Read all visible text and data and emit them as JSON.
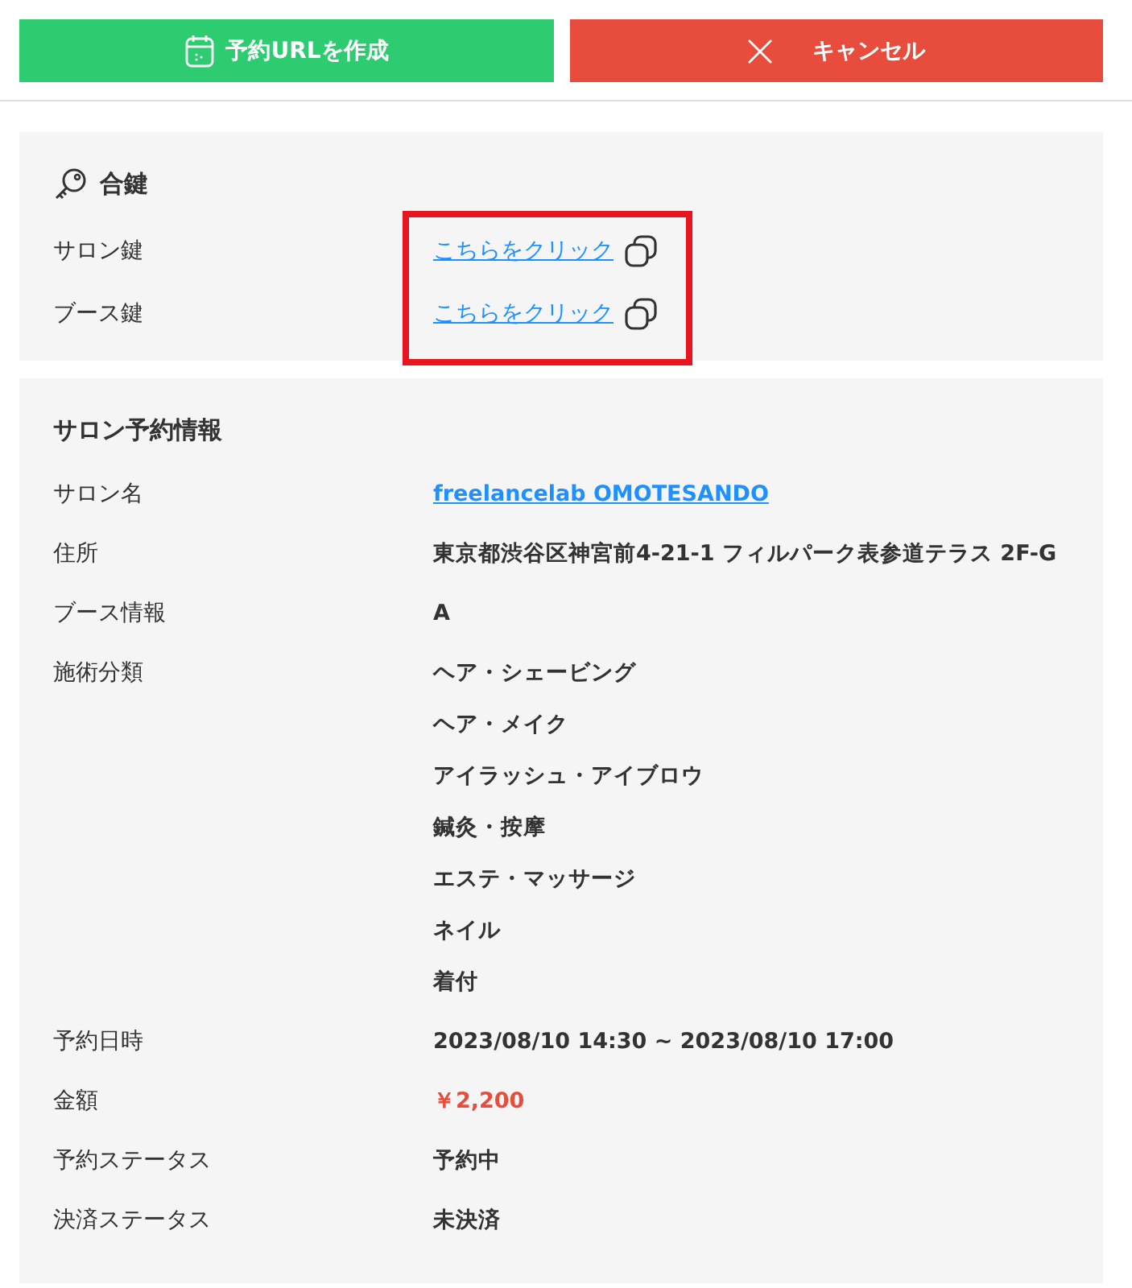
{
  "actions": [
    {
      "kind": "create",
      "label": "予約URLを作成"
    },
    {
      "kind": "cancel",
      "label": "キャンセル"
    }
  ],
  "keys": {
    "title": "合鍵",
    "highlighted": true,
    "rows": [
      {
        "label": "サロン鍵",
        "link": "こちらをクリック"
      },
      {
        "label": "ブース鍵",
        "link": "こちらをクリック"
      }
    ]
  },
  "reservation": {
    "title": "サロン予約情報",
    "rows": [
      {
        "kind": "link",
        "label": "サロン名",
        "value": "freelancelab OMOTESANDO"
      },
      {
        "kind": "text",
        "label": "住所",
        "value": "東京都渋谷区神宮前4-21-1 フィルパーク表参道テラス 2F-G"
      },
      {
        "kind": "text",
        "label": "ブース情報",
        "value": "A"
      },
      {
        "kind": "list",
        "label": "施術分類",
        "values": [
          "ヘア・シェービング",
          "ヘア・メイク",
          "アイラッシュ・アイブロウ",
          "鍼灸・按摩",
          "エステ・マッサージ",
          "ネイル",
          "着付"
        ]
      },
      {
        "kind": "text",
        "label": "予約日時",
        "value": "2023/08/10 14:30 ~ 2023/08/10 17:00"
      },
      {
        "kind": "price",
        "label": "金額",
        "value": "￥2,200"
      },
      {
        "kind": "text",
        "label": "予約ステータス",
        "value": "予約中"
      },
      {
        "kind": "text",
        "label": "決済ステータス",
        "value": "未決済"
      }
    ]
  }
}
